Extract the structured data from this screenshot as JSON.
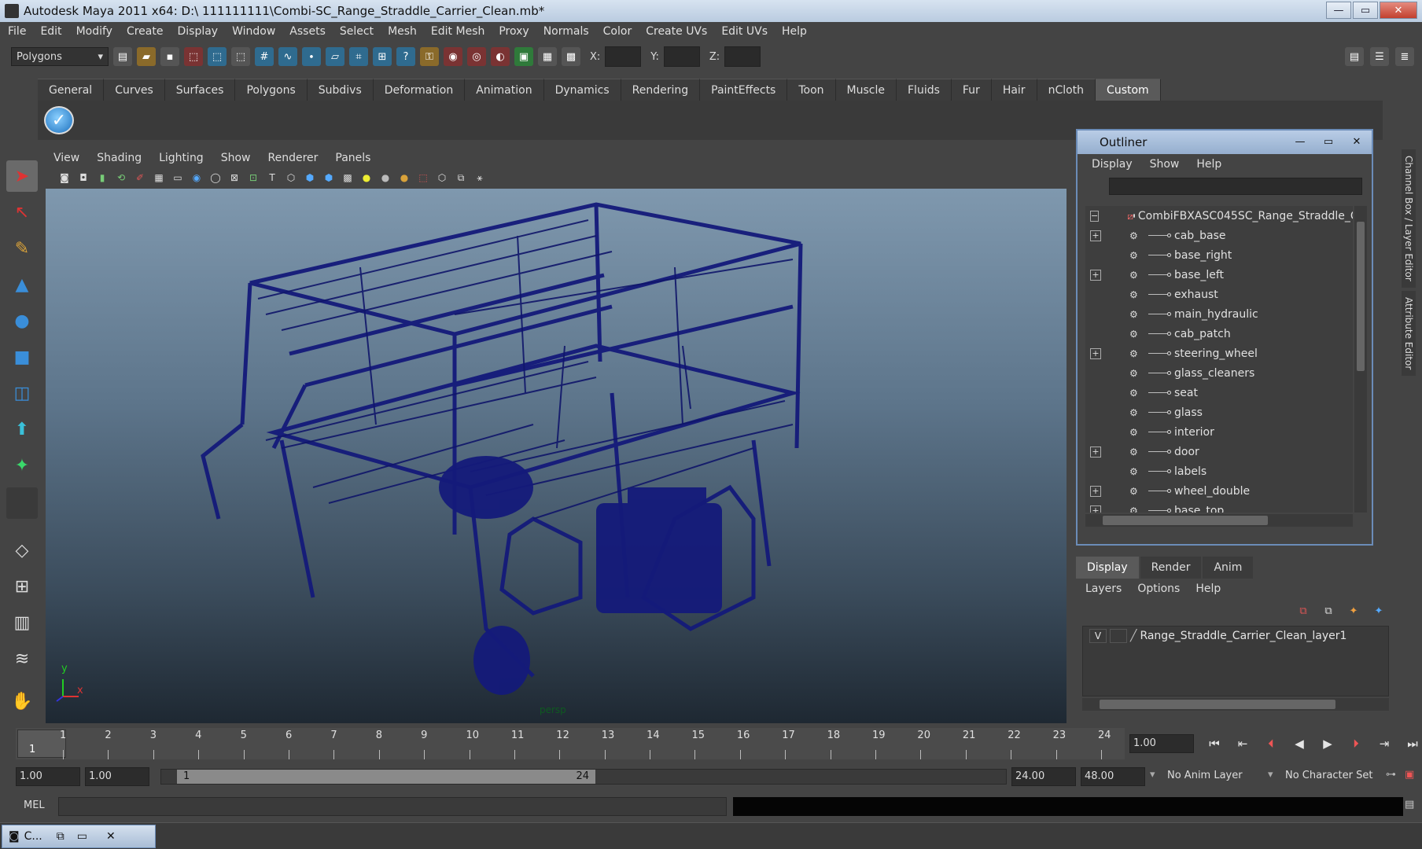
{
  "window": {
    "title": "Autodesk Maya 2011 x64: D:\\ 111111111\\Combi-SC_Range_Straddle_Carrier_Clean.mb*",
    "minimize": "—",
    "maximize": "▭",
    "close": "✕"
  },
  "menubar": [
    "File",
    "Edit",
    "Modify",
    "Create",
    "Display",
    "Window",
    "Assets",
    "Select",
    "Mesh",
    "Edit Mesh",
    "Proxy",
    "Normals",
    "Color",
    "Create UVs",
    "Edit UVs",
    "Help"
  ],
  "statusline": {
    "mode": "Polygons",
    "x_label": "X:",
    "y_label": "Y:",
    "z_label": "Z:"
  },
  "shelf": {
    "tabs": [
      "General",
      "Curves",
      "Surfaces",
      "Polygons",
      "Subdivs",
      "Deformation",
      "Animation",
      "Dynamics",
      "Rendering",
      "PaintEffects",
      "Toon",
      "Muscle",
      "Fluids",
      "Fur",
      "Hair",
      "nCloth",
      "Custom"
    ],
    "active_tab": "Custom"
  },
  "panel": {
    "menu": [
      "View",
      "Shading",
      "Lighting",
      "Show",
      "Renderer",
      "Panels"
    ],
    "camera_label": "persp",
    "axis_x": "x",
    "axis_y": "y"
  },
  "outliner": {
    "title": "Outliner",
    "menu": [
      "Display",
      "Show",
      "Help"
    ],
    "items": [
      {
        "label": "CombiFBXASC045SC_Range_Straddle_C",
        "expand": "−",
        "root": true
      },
      {
        "label": "cab_base",
        "expand": "+"
      },
      {
        "label": "base_right",
        "expand": ""
      },
      {
        "label": "base_left",
        "expand": "+"
      },
      {
        "label": "exhaust",
        "expand": ""
      },
      {
        "label": "main_hydraulic",
        "expand": ""
      },
      {
        "label": "cab_patch",
        "expand": ""
      },
      {
        "label": "steering_wheel",
        "expand": "+"
      },
      {
        "label": "glass_cleaners",
        "expand": ""
      },
      {
        "label": "seat",
        "expand": ""
      },
      {
        "label": "glass",
        "expand": ""
      },
      {
        "label": "interior",
        "expand": ""
      },
      {
        "label": "door",
        "expand": "+"
      },
      {
        "label": "labels",
        "expand": ""
      },
      {
        "label": "wheel_double",
        "expand": "+"
      },
      {
        "label": "base_top",
        "expand": "+"
      }
    ]
  },
  "side_tabs": [
    "Channel Box / Layer Editor",
    "Attribute Editor"
  ],
  "layer_editor": {
    "tabs": [
      "Display",
      "Render",
      "Anim"
    ],
    "active_tab": "Display",
    "menu": [
      "Layers",
      "Options",
      "Help"
    ],
    "layer_visible": "V",
    "layer_name": "Range_Straddle_Carrier_Clean_layer1"
  },
  "timeline": {
    "ticks": [
      "1",
      "2",
      "3",
      "4",
      "5",
      "6",
      "7",
      "8",
      "9",
      "10",
      "11",
      "12",
      "13",
      "14",
      "15",
      "16",
      "17",
      "18",
      "19",
      "20",
      "21",
      "22",
      "23",
      "24"
    ],
    "current_frame": "1",
    "current_time": "1.00"
  },
  "range": {
    "start_time": "1.00",
    "playback_start": "1.00",
    "range_start_label": "1",
    "range_end_label": "24",
    "playback_end": "24.00",
    "end_time": "48.00",
    "anim_layer": "No Anim Layer",
    "character_set": "No Character Set"
  },
  "command": {
    "label": "MEL"
  },
  "taskbar": {
    "item": "C..."
  }
}
